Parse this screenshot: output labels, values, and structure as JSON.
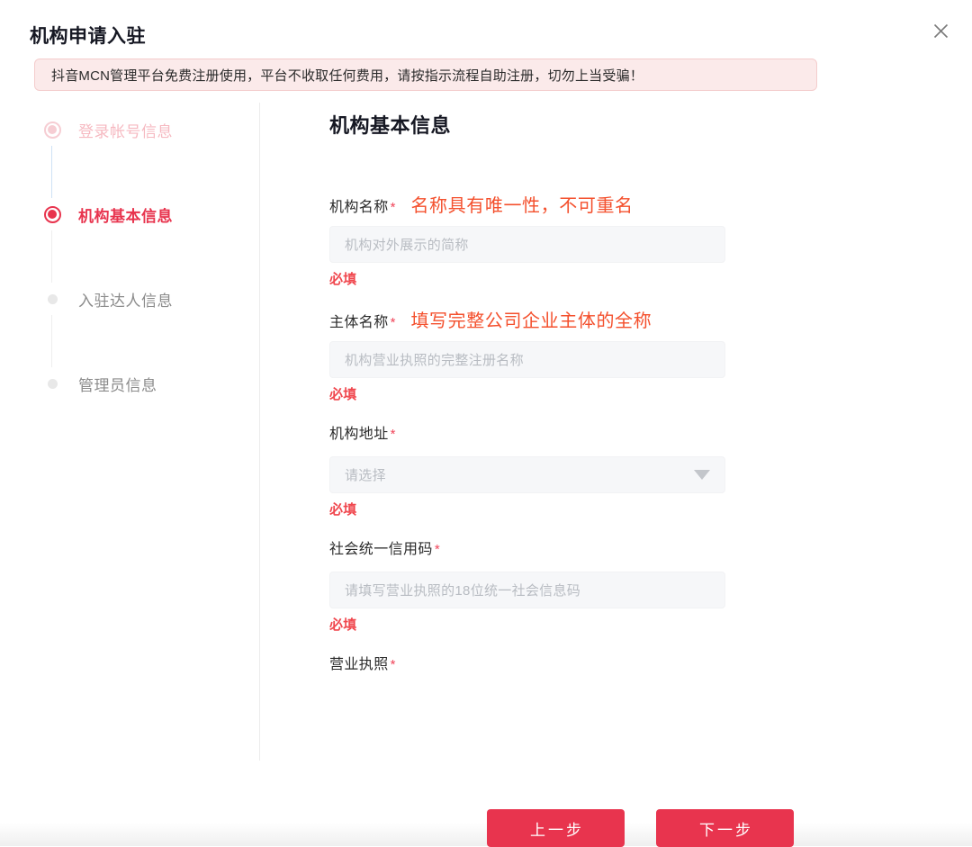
{
  "header": {
    "title": "机构申请入驻",
    "close_label": "×"
  },
  "notice": {
    "text": "抖音MCN管理平台免费注册使用，平台不收取任何费用，请按指示流程自助注册，切勿上当受骗！",
    "background": "#fbeaea",
    "border_color": "#f4cdcd"
  },
  "steps": {
    "items": [
      {
        "label": "登录帐号信息",
        "state": "done"
      },
      {
        "label": "机构基本信息",
        "state": "current"
      },
      {
        "label": "入驻达人信息",
        "state": "pending"
      },
      {
        "label": "管理员信息",
        "state": "pending"
      }
    ],
    "active_color": "#e8344e",
    "done_color": "#f6b9c1",
    "pending_color": "#8b8b8b"
  },
  "form": {
    "heading": "机构基本信息",
    "required_mark": "*",
    "fields": [
      {
        "label": "机构名称",
        "required": true,
        "hint": "名称具有唯一性，不可重名",
        "placeholder": "机构对外展示的简称",
        "error": "必填",
        "type": "text"
      },
      {
        "label": "主体名称",
        "required": true,
        "hint": "填写完整公司企业主体的全称",
        "placeholder": "机构营业执照的完整注册名称",
        "error": "必填",
        "type": "text"
      },
      {
        "label": "机构地址",
        "required": true,
        "hint": "",
        "placeholder": "请选择",
        "error": "必填",
        "type": "select"
      },
      {
        "label": "社会统一信用码",
        "required": true,
        "hint": "",
        "placeholder": "请填写营业执照的18位统一社会信息码",
        "error": "必填",
        "type": "text"
      },
      {
        "label": "营业执照",
        "required": true,
        "hint": "",
        "placeholder": "",
        "error": "",
        "type": "upload"
      }
    ],
    "hint_color": "#f4502d",
    "error_color": "#f0474e"
  },
  "footer": {
    "prev_label": "上一步",
    "next_label": "下一步",
    "button_color": "#e8344e"
  }
}
